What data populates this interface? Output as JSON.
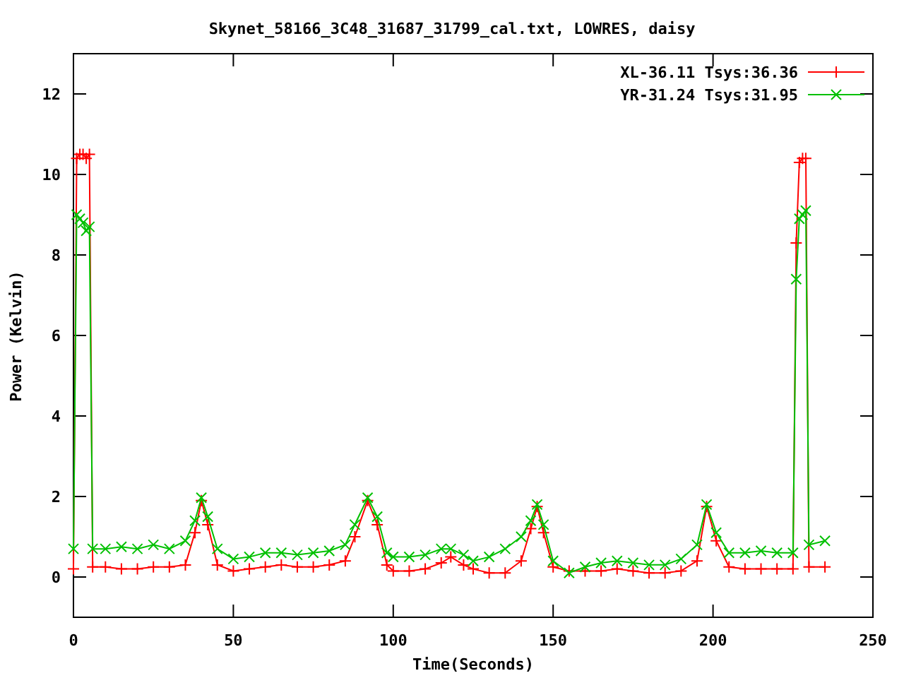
{
  "chart_data": {
    "type": "line",
    "title": "Skynet_58166_3C48_31687_31799_cal.txt, LOWRES, daisy",
    "xlabel": "Time(Seconds)",
    "ylabel": "Power (Kelvin)",
    "x": [
      0,
      1,
      2,
      3,
      4,
      5,
      6,
      10,
      15,
      20,
      25,
      30,
      35,
      38,
      40,
      42,
      45,
      50,
      55,
      60,
      65,
      70,
      75,
      80,
      85,
      88,
      92,
      95,
      98,
      100,
      105,
      110,
      115,
      118,
      122,
      125,
      130,
      135,
      140,
      143,
      145,
      147,
      150,
      155,
      160,
      165,
      170,
      175,
      180,
      185,
      190,
      195,
      198,
      201,
      205,
      210,
      215,
      220,
      225,
      226,
      227,
      228,
      229,
      230,
      235
    ],
    "series": [
      {
        "name": "XL-36.11 Tsys:36.36",
        "color": "#ff0000",
        "marker": "plus",
        "values": [
          0.2,
          10.4,
          10.5,
          10.5,
          10.4,
          10.5,
          0.25,
          0.25,
          0.2,
          0.2,
          0.25,
          0.25,
          0.3,
          1.1,
          1.9,
          1.3,
          0.3,
          0.15,
          0.2,
          0.25,
          0.3,
          0.25,
          0.25,
          0.3,
          0.4,
          1.0,
          1.9,
          1.3,
          0.3,
          0.15,
          0.15,
          0.2,
          0.35,
          0.5,
          0.3,
          0.2,
          0.1,
          0.1,
          0.4,
          1.2,
          1.75,
          1.1,
          0.25,
          0.15,
          0.15,
          0.15,
          0.2,
          0.15,
          0.1,
          0.1,
          0.15,
          0.4,
          1.75,
          0.9,
          0.25,
          0.2,
          0.2,
          0.2,
          0.2,
          8.3,
          10.3,
          10.4,
          10.4,
          0.25,
          0.25
        ]
      },
      {
        "name": "YR-31.24 Tsys:31.95",
        "color": "#00c000",
        "marker": "cross",
        "values": [
          0.7,
          9.0,
          8.9,
          8.8,
          8.6,
          8.7,
          0.7,
          0.7,
          0.75,
          0.7,
          0.8,
          0.7,
          0.9,
          1.4,
          1.97,
          1.5,
          0.7,
          0.45,
          0.5,
          0.6,
          0.6,
          0.55,
          0.6,
          0.65,
          0.8,
          1.3,
          1.97,
          1.5,
          0.6,
          0.5,
          0.5,
          0.55,
          0.7,
          0.7,
          0.55,
          0.4,
          0.5,
          0.7,
          1.0,
          1.4,
          1.8,
          1.3,
          0.4,
          0.1,
          0.25,
          0.35,
          0.4,
          0.35,
          0.3,
          0.3,
          0.45,
          0.8,
          1.8,
          1.1,
          0.6,
          0.6,
          0.65,
          0.6,
          0.6,
          7.4,
          8.9,
          9.0,
          9.1,
          0.8,
          0.9
        ]
      }
    ],
    "legend": true,
    "xlim": [
      0,
      250
    ],
    "ylim": [
      -1,
      13
    ],
    "xticks": [
      0,
      50,
      100,
      150,
      200,
      250
    ],
    "yticks": [
      0,
      2,
      4,
      6,
      8,
      10,
      12
    ]
  }
}
